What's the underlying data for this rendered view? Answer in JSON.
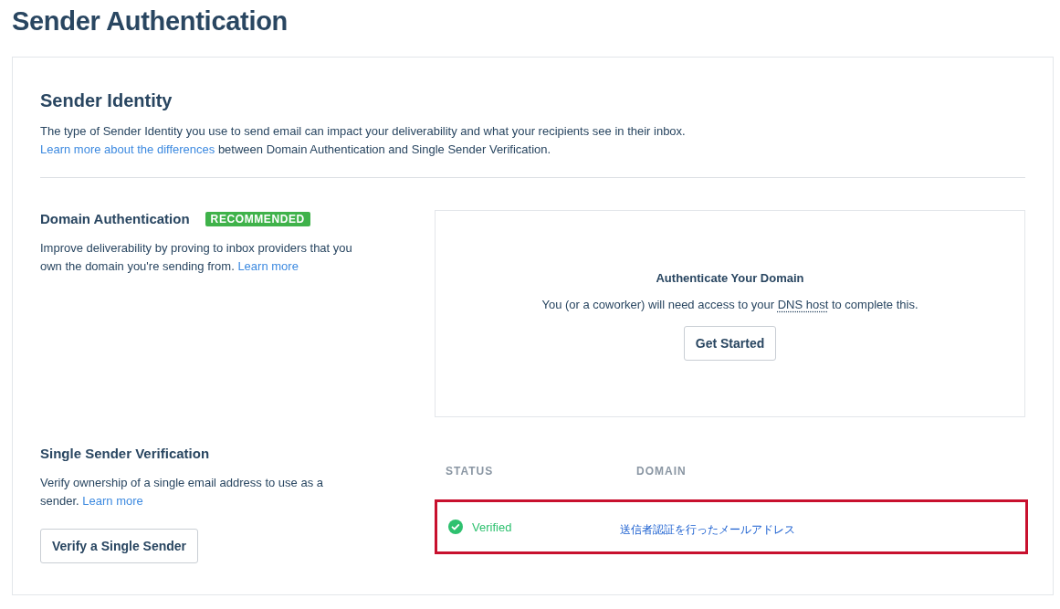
{
  "page_title": "Sender Authentication",
  "identity": {
    "title": "Sender Identity",
    "description": [
      {
        "kind": "text",
        "text": "The type of Sender Identity you use to send email can impact your deliverability and what your recipients see in their inbox."
      },
      {
        "kind": "break"
      },
      {
        "kind": "link",
        "text": "Learn more about the differences"
      },
      {
        "kind": "text",
        "text": " between Domain Authentication and Single Sender Verification."
      }
    ]
  },
  "domain_auth": {
    "title": "Domain Authentication",
    "badge": "RECOMMENDED",
    "description": [
      {
        "kind": "text",
        "text": "Improve deliverability by proving to inbox providers that you own the domain you're sending from. "
      },
      {
        "kind": "link",
        "text": "Learn more"
      }
    ],
    "panel": {
      "title": "Authenticate Your Domain",
      "description": [
        {
          "kind": "text",
          "text": "You (or a coworker) will need access to your "
        },
        {
          "kind": "term",
          "text": "DNS host"
        },
        {
          "kind": "text",
          "text": " to complete this."
        }
      ],
      "button": "Get Started"
    }
  },
  "single_sender": {
    "title": "Single Sender Verification",
    "description": [
      {
        "kind": "text",
        "text": "Verify ownership of a single email address to use as a sender. "
      },
      {
        "kind": "link",
        "text": "Learn more"
      }
    ],
    "button": "Verify a Single Sender",
    "table": {
      "columns": [
        "STATUS",
        "DOMAIN"
      ],
      "rows": [
        {
          "status": "Verified",
          "kind": "verified",
          "domain": "送信者認証を行ったメールアドレス",
          "highlighted": true
        }
      ]
    }
  }
}
